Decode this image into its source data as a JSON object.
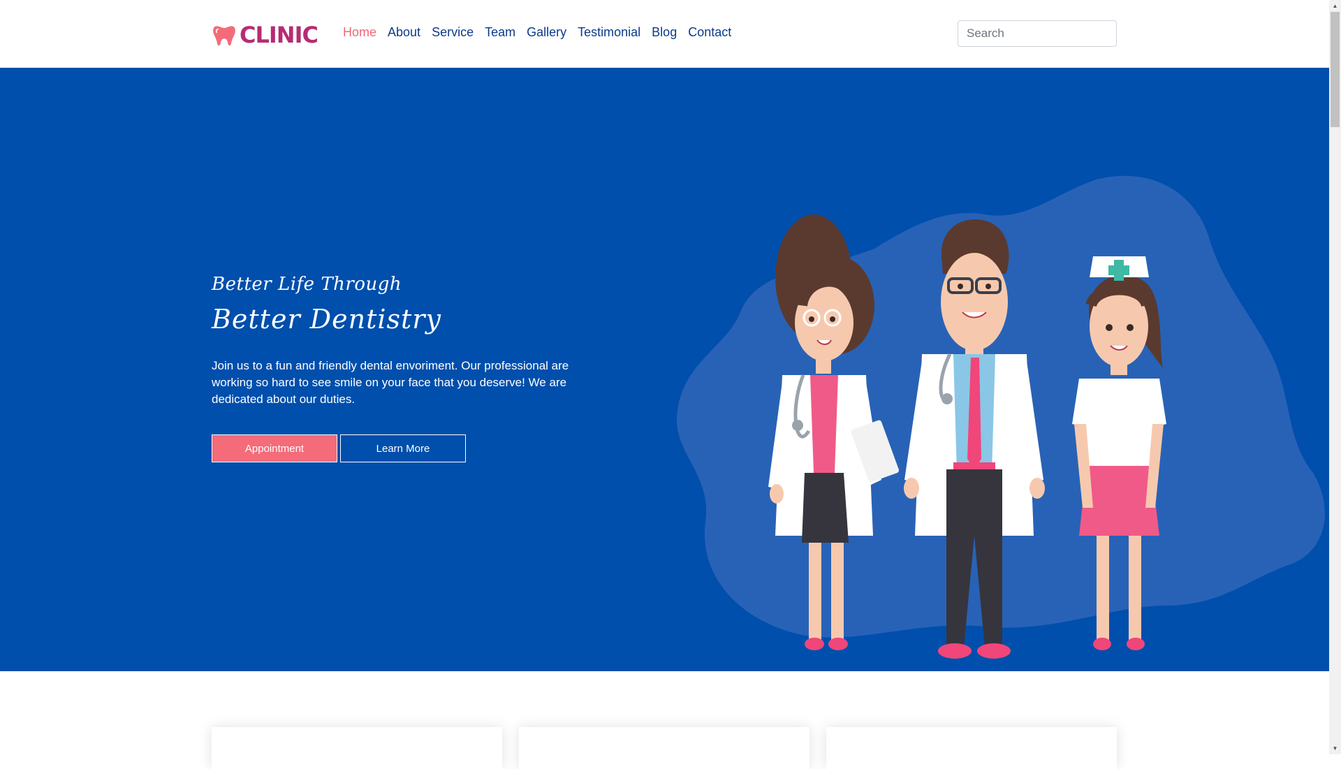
{
  "brand": {
    "name": "CLINIC",
    "icon": "tooth-icon",
    "color": "#b72b74"
  },
  "nav": {
    "items": [
      {
        "label": "Home",
        "active": true
      },
      {
        "label": "About"
      },
      {
        "label": "Service"
      },
      {
        "label": "Team"
      },
      {
        "label": "Gallery"
      },
      {
        "label": "Testimonial"
      },
      {
        "label": "Blog"
      },
      {
        "label": "Contact"
      }
    ],
    "active_color": "#f06775",
    "color": "#0b3b8c"
  },
  "search": {
    "placeholder": "Search",
    "value": ""
  },
  "hero": {
    "subtitle": "Better Life Through",
    "title": "Better Dentistry",
    "description": "Join us to a fun and friendly dental envoriment. Our professional are working so hard to see smile on your face that you deserve! We are dedicated about our duties.",
    "primary_button": "Appointment",
    "secondary_button": "Learn More",
    "background": "#004fac",
    "illustration": "medical-staff-illustration"
  },
  "colors": {
    "accent": "#f46b7a",
    "hero_bg": "#004fac",
    "blob": "#2a63b6"
  }
}
